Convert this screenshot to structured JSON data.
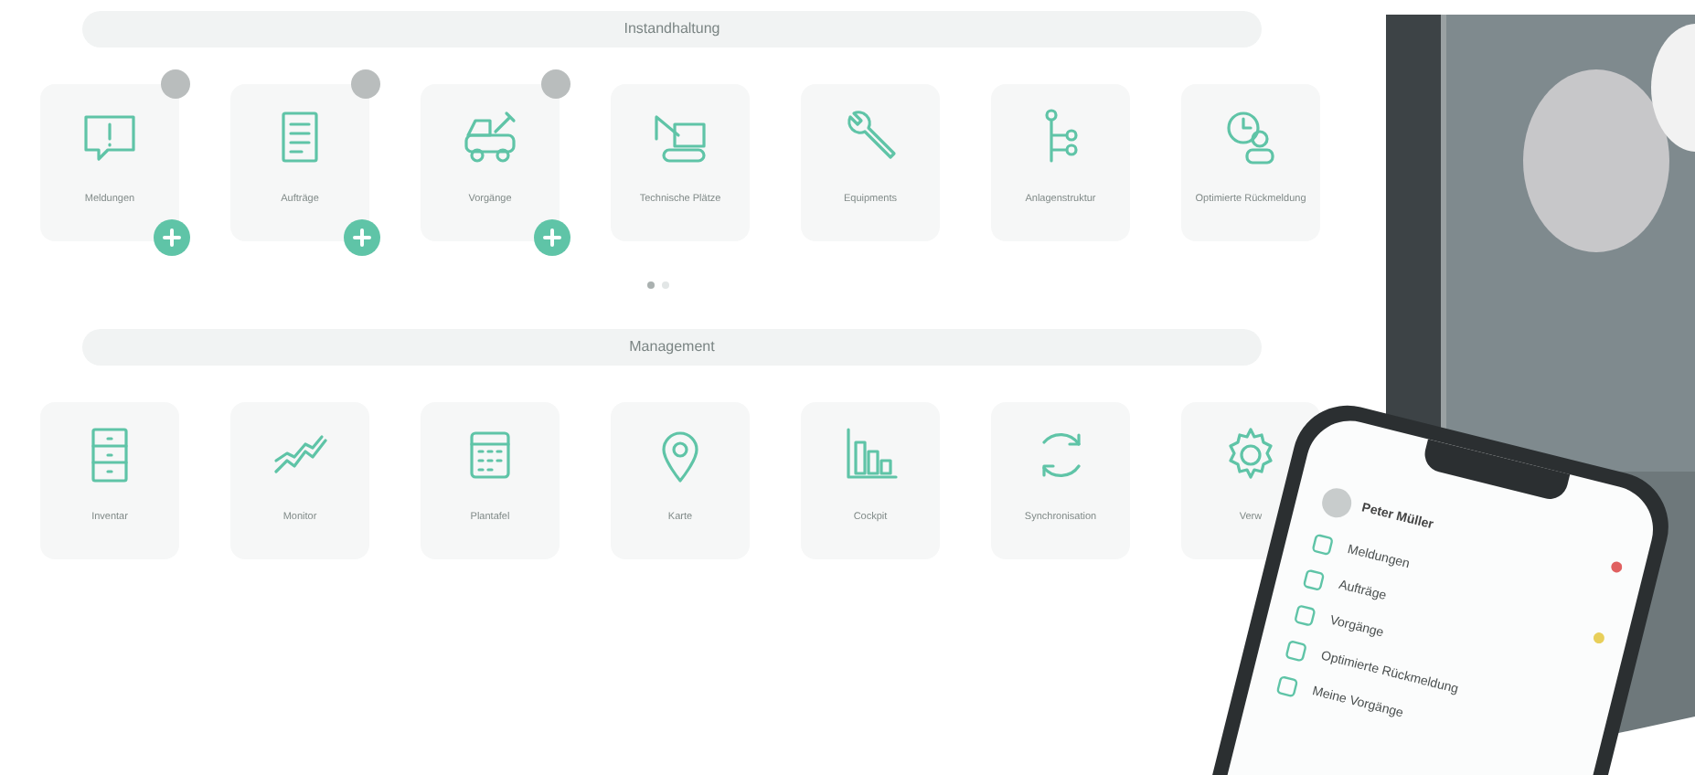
{
  "sections": [
    {
      "title": "Instandhaltung",
      "tiles": [
        {
          "label": "Meldungen",
          "badge": true,
          "add": true
        },
        {
          "label": "Aufträge",
          "badge": true,
          "add": true
        },
        {
          "label": "Vorgänge",
          "badge": true,
          "add": true
        },
        {
          "label": "Technische Plätze",
          "badge": false,
          "add": false
        },
        {
          "label": "Equipments",
          "badge": false,
          "add": false
        },
        {
          "label": "Anlagenstruktur",
          "badge": false,
          "add": false
        },
        {
          "label": "Optimierte Rückmeldung",
          "badge": false,
          "add": false
        }
      ],
      "pager": [
        {
          "selected": true
        },
        {
          "selected": false
        }
      ]
    },
    {
      "title": "Management",
      "tiles": [
        {
          "label": "Inventar",
          "badge": false,
          "add": false
        },
        {
          "label": "Monitor",
          "badge": false,
          "add": false
        },
        {
          "label": "Plantafel",
          "badge": false,
          "add": false
        },
        {
          "label": "Karte",
          "badge": false,
          "add": false
        },
        {
          "label": "Cockpit",
          "badge": false,
          "add": false
        },
        {
          "label": "Synchronisation",
          "badge": false,
          "add": false
        },
        {
          "label": "Verw",
          "badge": false,
          "add": false
        }
      ]
    }
  ],
  "phone": {
    "user": "Peter Müller",
    "menu": [
      "Meldungen",
      "Aufträge",
      "Vorgänge",
      "Optimierte Rückmeldung",
      "Meine Vorgänge"
    ],
    "marks": [
      {
        "color": "#e06060"
      },
      {
        "color": "#e8cf5a"
      }
    ]
  }
}
